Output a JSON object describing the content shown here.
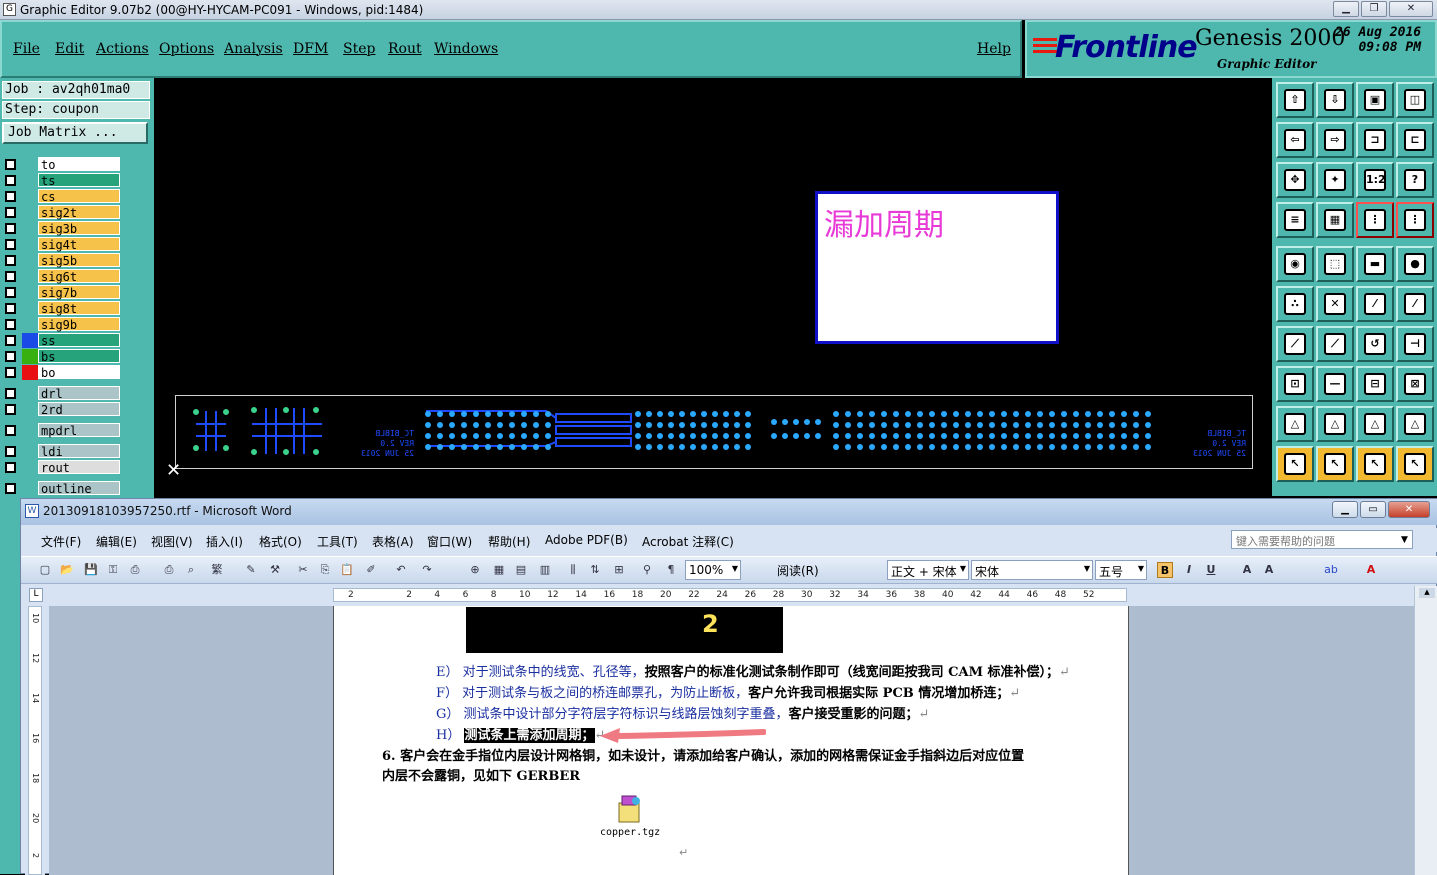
{
  "genesis": {
    "title": "Graphic Editor 9.07b2 (00@HY-HYCAM-PC091 - Windows, pid:1484)",
    "menu": [
      "File",
      "Edit",
      "Actions",
      "Options",
      "Analysis",
      "DFM",
      "Step",
      "Rout",
      "Windows"
    ],
    "help": "Help",
    "logo": "Frontline",
    "product": "Genesis 2000",
    "subtitle": "Graphic Editor",
    "date": "26 Aug 2016",
    "time": "09:08 PM",
    "job": "Job  : av2qh01ma0",
    "step": "Step: coupon",
    "job_matrix": "Job Matrix ...",
    "layers": [
      {
        "name": "to",
        "color": "#ffffff",
        "swatch": ""
      },
      {
        "name": "ts",
        "color": "#27a37b",
        "swatch": ""
      },
      {
        "name": "cs",
        "color": "#f7c24a",
        "swatch": ""
      },
      {
        "name": "sig2t",
        "color": "#f7c24a",
        "swatch": ""
      },
      {
        "name": "sig3b",
        "color": "#f7c24a",
        "swatch": ""
      },
      {
        "name": "sig4t",
        "color": "#f7c24a",
        "swatch": ""
      },
      {
        "name": "sig5b",
        "color": "#f7c24a",
        "swatch": ""
      },
      {
        "name": "sig6t",
        "color": "#f7c24a",
        "swatch": ""
      },
      {
        "name": "sig7b",
        "color": "#f7c24a",
        "swatch": ""
      },
      {
        "name": "sig8t",
        "color": "#f7c24a",
        "swatch": ""
      },
      {
        "name": "sig9b",
        "color": "#f7c24a",
        "swatch": ""
      },
      {
        "name": "ss",
        "color": "#27a37b",
        "swatch": "#1a4be6"
      },
      {
        "name": "bs",
        "color": "#27a37b",
        "swatch": "#38b010"
      },
      {
        "name": "bo",
        "color": "#ffffff",
        "swatch": "#e81010"
      },
      {
        "name": "drl",
        "color": "#aac4c7",
        "swatch": ""
      },
      {
        "name": "2rd",
        "color": "#aac4c7",
        "swatch": ""
      },
      {
        "name": "mpdrl",
        "color": "#aac4c7",
        "swatch": ""
      },
      {
        "name": "ldi",
        "color": "#aac4c7",
        "swatch": ""
      },
      {
        "name": "rout",
        "color": "#dddddd",
        "swatch": ""
      },
      {
        "name": "outline",
        "color": "#aac4c7",
        "swatch": ""
      }
    ],
    "annotation": "漏加周期",
    "coupon_text": [
      "TC_BIBLB",
      "REV 2.0",
      "25 JUN 2013"
    ]
  },
  "word": {
    "title": "20130918103957250.rtf - Microsoft Word",
    "menu": [
      "文件(F)",
      "编辑(E)",
      "视图(V)",
      "插入(I)",
      "格式(O)",
      "工具(T)",
      "表格(A)",
      "窗口(W)",
      "帮助(H)",
      "Adobe PDF(B)",
      "Acrobat 注释(C)"
    ],
    "help_placeholder": "键入需要帮助的问题",
    "zoom": "100%",
    "read_mode": "阅读(R)",
    "style": "正文 + 宋体",
    "font": "宋体",
    "size": "五号",
    "image_digit": "2",
    "lines": {
      "e_prefix": "E） 对于测试条中的线宽、孔径等，",
      "e_bold": "按照客户的标准化测试条制作即可（线宽间距按我司 CAM 标准补偿）；",
      "f_prefix": "F） 对于测试条与板之间的桥连邮票孔，为防止断板，",
      "f_bold": "客户允许我司根据实际 PCB 情况增加桥连；",
      "g_prefix": "G） 测试条中设计部分字符层字符标识与线路层蚀刻字重叠，",
      "g_bold": "客户接受重影的问题；",
      "h_prefix": "H） ",
      "h_highlight": "测试条上需添加周期；",
      "p6_line1": "6.  客户会在金手指位内层设计网格铜，如未设计，请添加给客户确认，添加的网格需保证金手指斜边后对应位置",
      "p6_line2": "内层不会露铜，见如下 GERBER"
    },
    "attachment": "copper.tgz",
    "ruler_h": [
      "2",
      "2",
      "4",
      "6",
      "8",
      "10",
      "12",
      "14",
      "16",
      "18",
      "20",
      "22",
      "24",
      "26",
      "28",
      "30",
      "32",
      "34",
      "36",
      "38",
      "40",
      "42",
      "44",
      "46",
      "48",
      "52"
    ],
    "ruler_v": [
      "10",
      "12",
      "14",
      "16",
      "18",
      "20",
      "2"
    ]
  }
}
